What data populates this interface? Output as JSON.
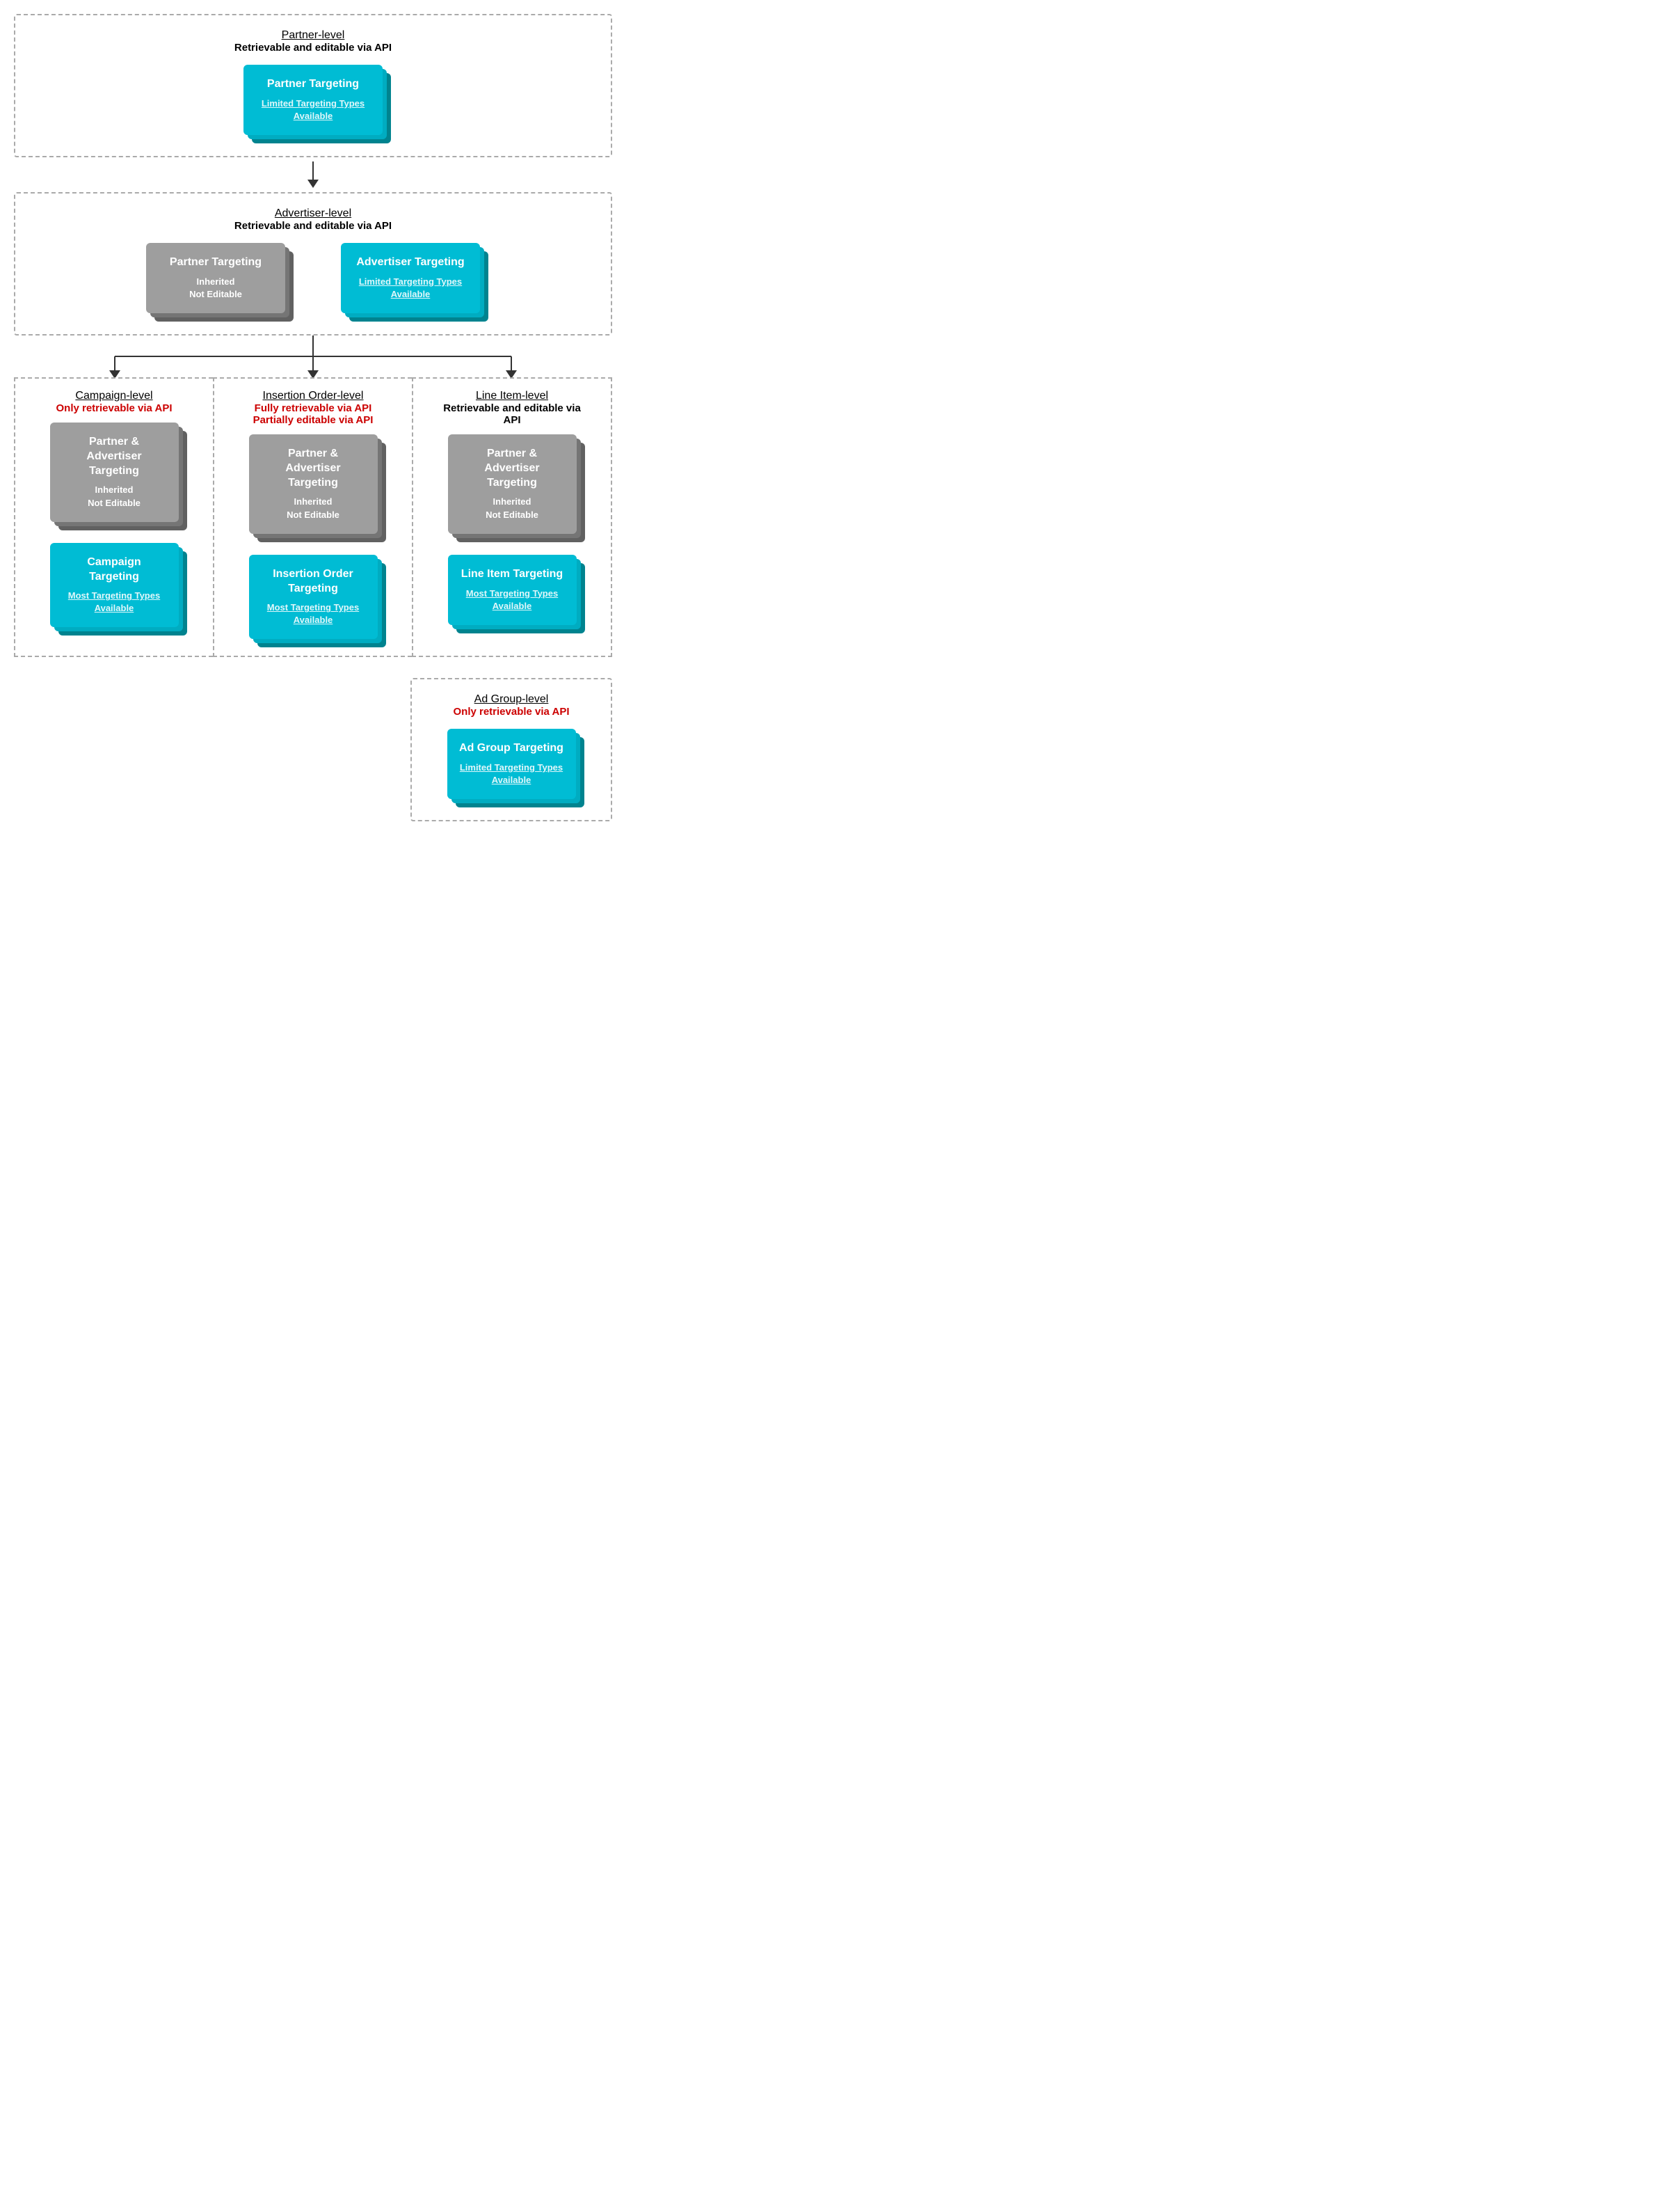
{
  "levels": {
    "partner": {
      "name": "Partner-level",
      "desc": "Retrievable and editable via API",
      "desc_color": "black",
      "cards": [
        {
          "type": "teal",
          "title": "Partner Targeting",
          "subtitle_type": "link",
          "subtitle": "Limited Targeting Types\nAvailable"
        }
      ]
    },
    "advertiser": {
      "name": "Advertiser-level",
      "desc": "Retrievable and editable via API",
      "desc_color": "black",
      "cards": [
        {
          "type": "gray",
          "title": "Partner Targeting",
          "subtitle_type": "text",
          "subtitle": "Inherited\nNot Editable"
        },
        {
          "type": "teal",
          "title": "Advertiser Targeting",
          "subtitle_type": "link",
          "subtitle": "Limited Targeting Types\nAvailable"
        }
      ]
    },
    "campaign": {
      "name": "Campaign-level",
      "desc": "Only retrievable via API",
      "desc_color": "red",
      "cards": [
        {
          "type": "gray",
          "title": "Partner & Advertiser\nTargeting",
          "subtitle_type": "text",
          "subtitle": "Inherited\nNot Editable"
        },
        {
          "type": "teal",
          "title": "Campaign Targeting",
          "subtitle_type": "link",
          "subtitle": "Most Targeting Types\nAvailable"
        }
      ]
    },
    "insertion_order": {
      "name": "Insertion Order-level",
      "desc1": "Fully retrievable via API",
      "desc2": "Partially editable via API",
      "desc_color": "red",
      "cards": [
        {
          "type": "gray",
          "title": "Partner & Advertiser\nTargeting",
          "subtitle_type": "text",
          "subtitle": "Inherited\nNot Editable"
        },
        {
          "type": "teal",
          "title": "Insertion Order\nTargeting",
          "subtitle_type": "link",
          "subtitle": "Most Targeting Types\nAvailable"
        }
      ]
    },
    "line_item": {
      "name": "Line Item-level",
      "desc": "Retrievable and editable via\nAPI",
      "desc_color": "black",
      "cards": [
        {
          "type": "gray",
          "title": "Partner & Advertiser\nTargeting",
          "subtitle_type": "text",
          "subtitle": "Inherited\nNot Editable"
        },
        {
          "type": "teal",
          "title": "Line Item Targeting",
          "subtitle_type": "link",
          "subtitle": "Most Targeting Types\nAvailable"
        }
      ]
    },
    "ad_group": {
      "name": "Ad Group-level",
      "desc": "Only retrievable via API",
      "desc_color": "red",
      "cards": [
        {
          "type": "teal",
          "title": "Ad Group Targeting",
          "subtitle_type": "link",
          "subtitle": "Limited Targeting Types\nAvailable"
        }
      ]
    }
  },
  "colors": {
    "teal_primary": "#00bcd4",
    "teal_dark1": "#00acc1",
    "teal_dark2": "#00838f",
    "gray_primary": "#9e9e9e",
    "gray_dark1": "#757575",
    "gray_dark2": "#616161",
    "red": "#cc0000",
    "arrow": "#333333",
    "border": "#aaaaaa"
  }
}
